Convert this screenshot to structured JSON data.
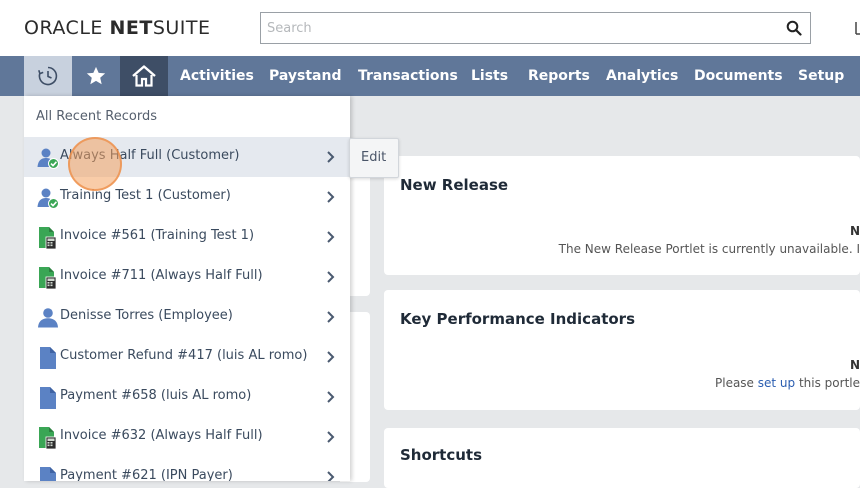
{
  "header": {
    "logo_oracle": "ORACLE",
    "logo_netsuite_bold": "NET",
    "logo_netsuite_rest": "SUITE",
    "search_placeholder": "Search"
  },
  "nav": {
    "items": [
      {
        "label": "Activities"
      },
      {
        "label": "Paystand"
      },
      {
        "label": "Transactions"
      },
      {
        "label": "Lists"
      },
      {
        "label": "Reports"
      },
      {
        "label": "Analytics"
      },
      {
        "label": "Documents"
      },
      {
        "label": "Setup"
      }
    ]
  },
  "recent_records": {
    "header": "All Recent Records",
    "edit_label": "Edit",
    "items": [
      {
        "label": "Always Half Full (Customer)",
        "icon": "customer-icon"
      },
      {
        "label": "Training Test 1 (Customer)",
        "icon": "customer-icon"
      },
      {
        "label": "Invoice #561 (Training Test 1)",
        "icon": "invoice-icon"
      },
      {
        "label": "Invoice #711 (Always Half Full)",
        "icon": "invoice-icon"
      },
      {
        "label": "Denisse Torres (Employee)",
        "icon": "employee-icon"
      },
      {
        "label": "Customer Refund #417 (luis AL romo)",
        "icon": "document-icon"
      },
      {
        "label": "Payment #658 (luis AL romo)",
        "icon": "document-icon"
      },
      {
        "label": "Invoice #632 (Always Half Full)",
        "icon": "invoice-icon"
      },
      {
        "label": "Payment #621 (IPN Payer)",
        "icon": "document-icon"
      }
    ]
  },
  "portlets": {
    "new_release": {
      "title": "New Release",
      "n": "N",
      "message": "The New Release Portlet is currently unavailable. I"
    },
    "kpi": {
      "title": "Key Performance Indicators",
      "n": "N",
      "msg_before": "Please ",
      "msg_link": "set up",
      "msg_after": " this portle"
    },
    "shortcuts": {
      "title": "Shortcuts"
    }
  },
  "colors": {
    "navbar": "#607799",
    "home_active": "#3e4e66",
    "recent_active": "#c8d1de",
    "customer_icon": "#5b82c4",
    "check_badge": "#3aa655",
    "invoice_icon": "#3aa655"
  }
}
